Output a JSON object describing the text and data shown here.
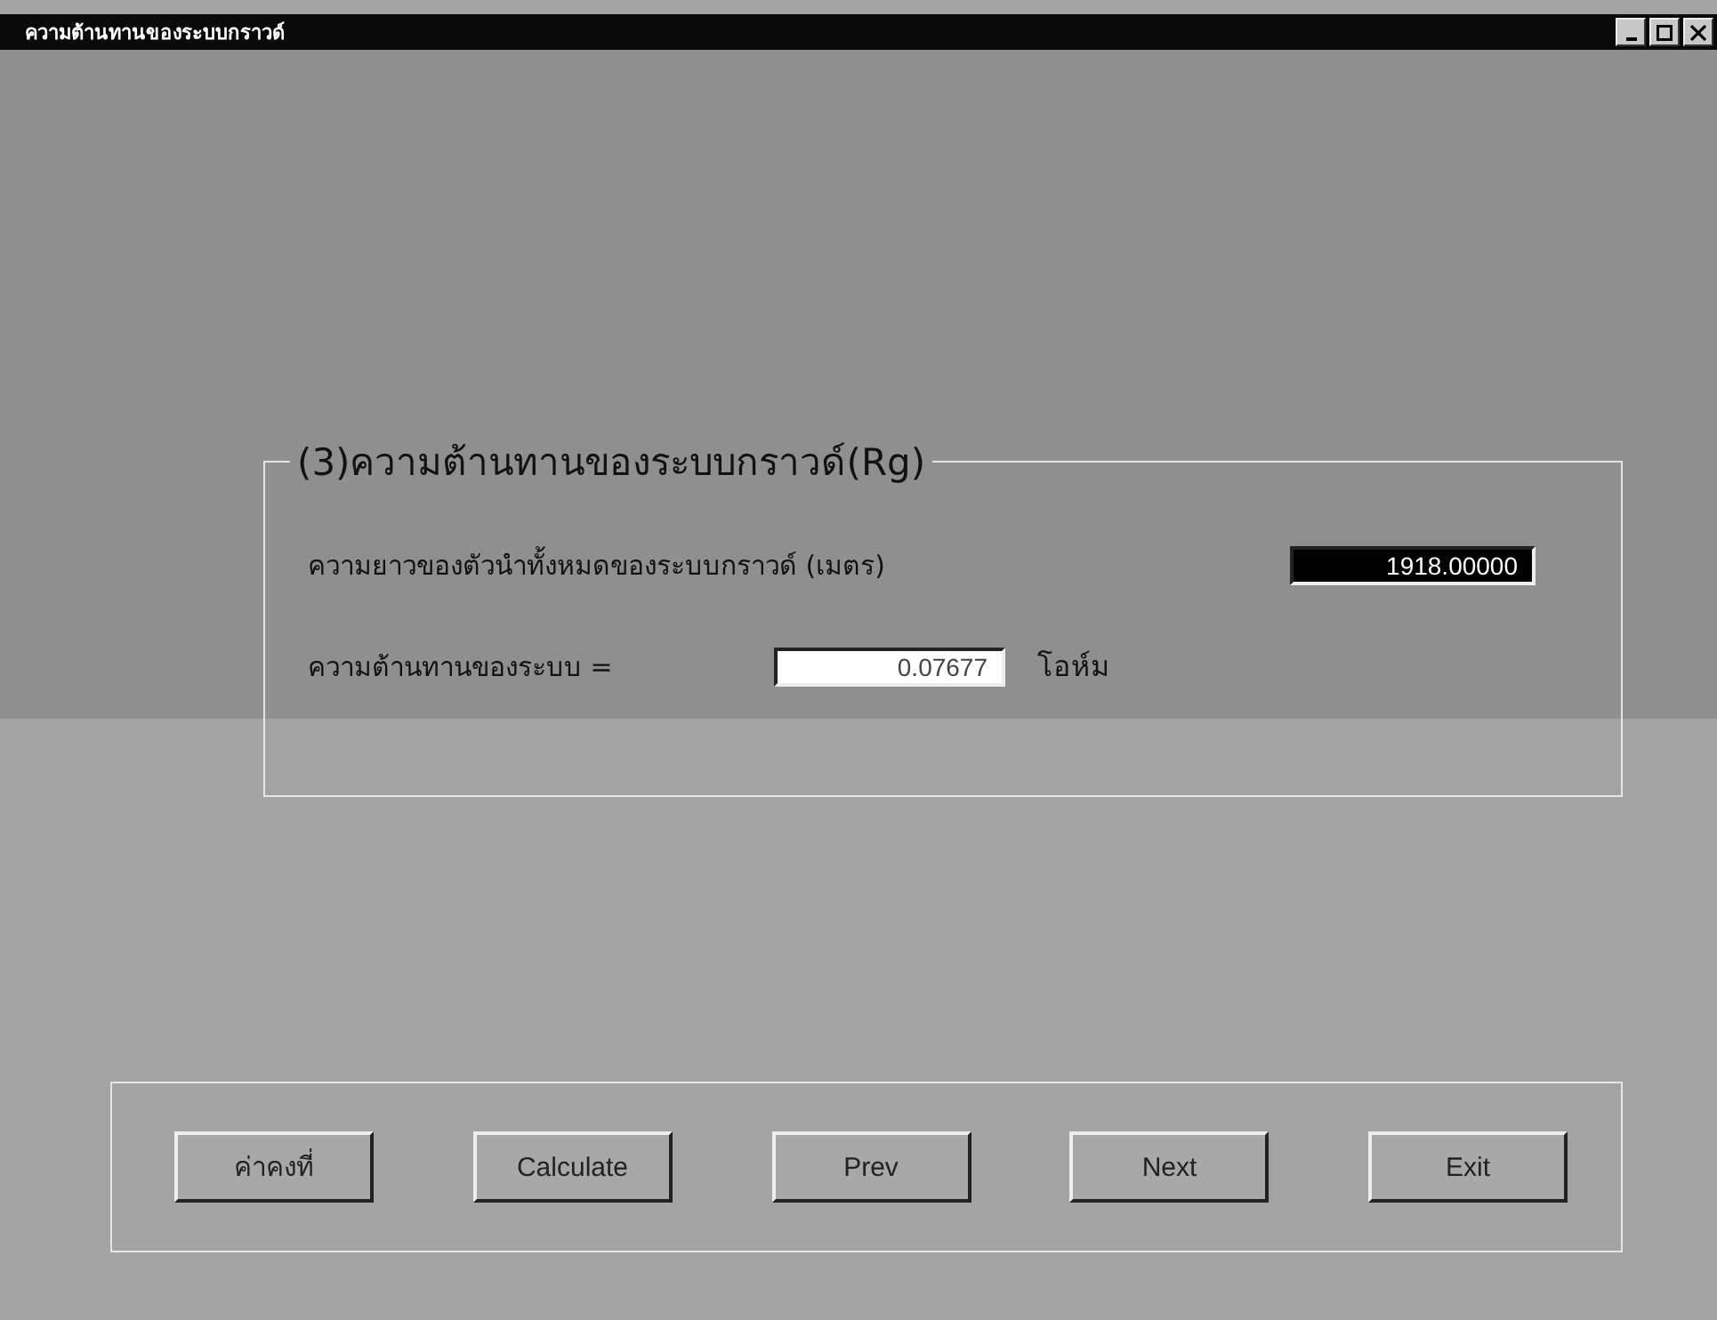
{
  "window": {
    "title": "ความต้านทานของระบบกราวด์"
  },
  "group": {
    "title": "(3)ความต้านทานของระบบกราวด์(Rg)",
    "fields": [
      {
        "label": "ความยาวของตัวนำทั้งหมดของระบบกราวด์ (เมตร)",
        "value": "1918.00000",
        "selected": true
      },
      {
        "label": "ความต้านทานของระบบ =",
        "value": "0.07677",
        "selected": false,
        "unit": "โอห์ม"
      }
    ]
  },
  "buttons": [
    "ค่าคงที่",
    "Calculate",
    "Prev",
    "Next",
    "Exit"
  ]
}
